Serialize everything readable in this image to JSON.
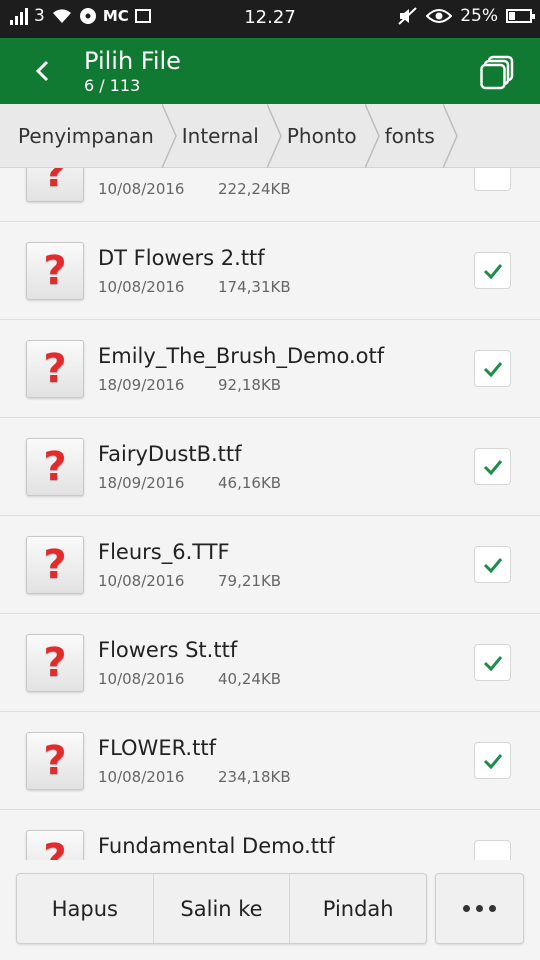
{
  "status_bar": {
    "signal_label": "3",
    "mc_label": "MC",
    "time": "12.27",
    "battery": "25%"
  },
  "app_bar": {
    "title": "Pilih File",
    "subtitle": "6 / 113"
  },
  "breadcrumb": [
    "Penyimpanan",
    "Internal",
    "Phonto",
    "fonts"
  ],
  "files": [
    {
      "name": "",
      "date": "10/08/2016",
      "size": "222,24KB",
      "checked": false
    },
    {
      "name": "DT Flowers 2.ttf",
      "date": "10/08/2016",
      "size": "174,31KB",
      "checked": true
    },
    {
      "name": "Emily_The_Brush_Demo.otf",
      "date": "18/09/2016",
      "size": "92,18KB",
      "checked": true
    },
    {
      "name": "FairyDustB.ttf",
      "date": "18/09/2016",
      "size": "46,16KB",
      "checked": true
    },
    {
      "name": "Fleurs_6.TTF",
      "date": "10/08/2016",
      "size": "79,21KB",
      "checked": true
    },
    {
      "name": "Flowers St.ttf",
      "date": "10/08/2016",
      "size": "40,24KB",
      "checked": true
    },
    {
      "name": "FLOWER.ttf",
      "date": "10/08/2016",
      "size": "234,18KB",
      "checked": true
    },
    {
      "name": "Fundamental Demo.ttf",
      "date": "",
      "size": "",
      "checked": false
    }
  ],
  "file_icon_glyph": "?",
  "actions": {
    "delete": "Hapus",
    "copy_to": "Salin ke",
    "move": "Pindah"
  },
  "colors": {
    "app_bar": "#117a32",
    "check": "#1e8c4a",
    "file_icon": "#e22b2b"
  }
}
